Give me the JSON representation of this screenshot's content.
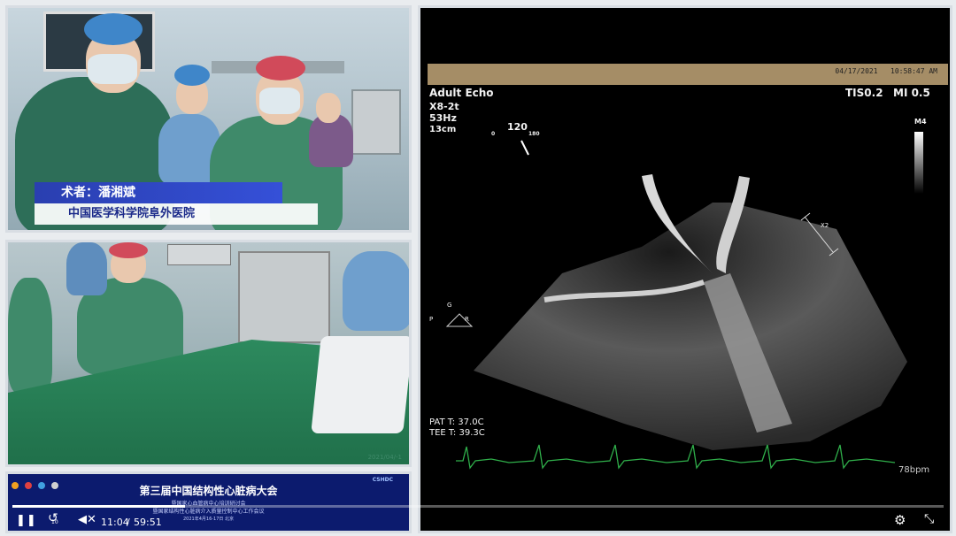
{
  "surgeon_caption": {
    "name": "术者：潘湘斌",
    "hospital": "中国医学科学院阜外医院"
  },
  "camera2": {
    "timestamp_fragment": "2021/04/-1"
  },
  "conference_banner": {
    "title": "第三届中国结构性心脏病大会",
    "subtitle1": "暨国家心血管病中心培训研讨会",
    "subtitle2": "暨国家结构性心脏病介入质量控制中心工作会议",
    "footer": "2021年4月16-17日 北京",
    "logo": "CSHDC"
  },
  "echo": {
    "date": "04/17/2021",
    "time": "10:58:47 AM",
    "mode": "Adult Echo",
    "probe": "X8-2t",
    "frequency": "53Hz",
    "depth": "13cm",
    "tis": "TIS0.2",
    "mi": "MI 0.5",
    "angle": "120",
    "angle_min": "0",
    "angle_max": "180",
    "map": "M4",
    "pat_temp": "PAT T: 37.0C",
    "tee_temp": "TEE T: 39.3C",
    "heart_rate": "78bpm",
    "scale_label": "X2",
    "orient_g": "G",
    "orient_p": "P",
    "orient_r": "R"
  },
  "player": {
    "current_time": "11:04",
    "separator": "/",
    "duration": "59:51",
    "rewind_label": "10",
    "progress": 0.185,
    "icons": [
      "pause-icon",
      "rewind-10-icon",
      "volume-icon",
      "settings-icon",
      "exit-fullscreen-icon"
    ]
  },
  "colors": {
    "ecg": "#2fae4a",
    "banner_bg": "#0c1b6e",
    "caption_blue": "#2a3fb0"
  }
}
